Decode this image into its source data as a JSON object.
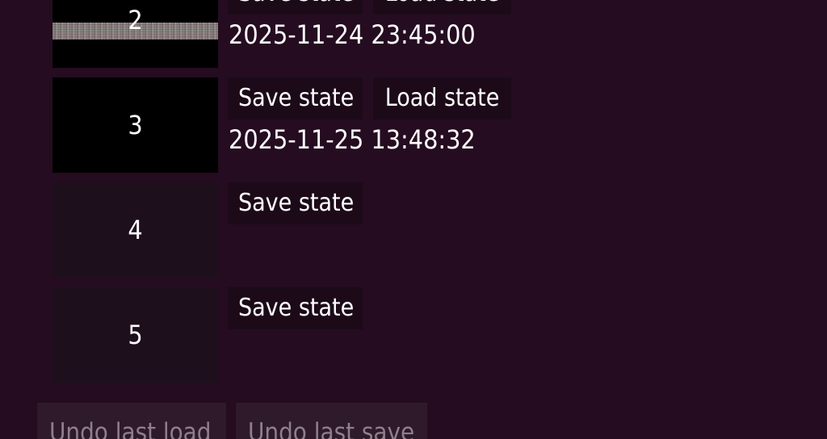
{
  "slots": [
    {
      "number": "2",
      "thumbnail": "game-screenshot",
      "save_label": "Save state",
      "load_label": "Load state",
      "timestamp": "2025-11-24 23:45:00"
    },
    {
      "number": "3",
      "thumbnail": "black",
      "save_label": "Save state",
      "load_label": "Load state",
      "timestamp": "2025-11-25 13:48:32"
    },
    {
      "number": "4",
      "thumbnail": "empty",
      "save_label": "Save state"
    },
    {
      "number": "5",
      "thumbnail": "empty",
      "save_label": "Save state"
    }
  ],
  "actions": {
    "undo_load_label": "Undo last load",
    "undo_save_label": "Undo last save"
  },
  "colors": {
    "background": "#250c20",
    "button_background": "#1c0a18",
    "empty_thumbnail": "#1e0f1c",
    "disabled_button_background": "#2e1a2a",
    "disabled_text": "#8e7f8b"
  }
}
